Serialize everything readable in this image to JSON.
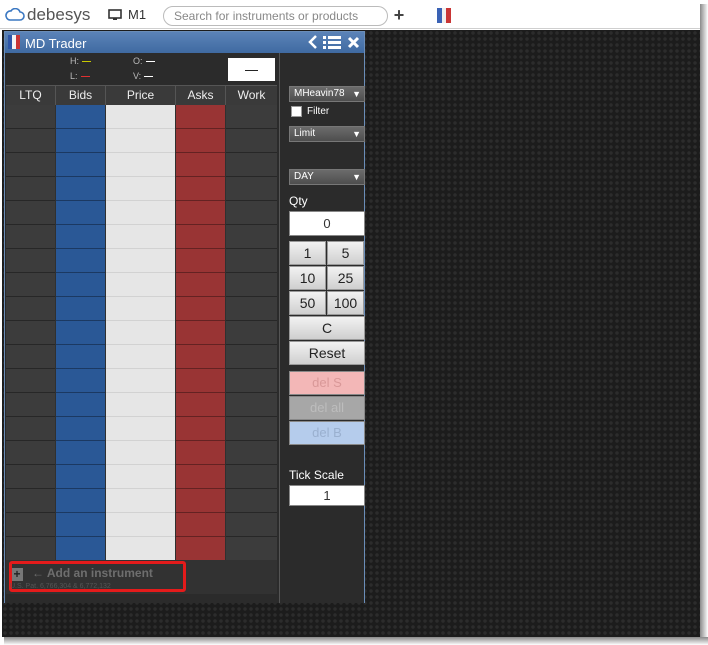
{
  "topbar": {
    "brand": "debesys",
    "workspace_label": "M1",
    "search_placeholder": "Search for instruments or products",
    "add_symbol": "+"
  },
  "widget": {
    "title": "MD Trader",
    "stats": {
      "high_label": "H:",
      "low_label": "L:",
      "open_label": "O:",
      "volume_label": "V:",
      "last_value": "—"
    },
    "columns": [
      "LTQ",
      "Bids",
      "Price",
      "Asks",
      "Work"
    ],
    "add_instrument_label": "Add an instrument",
    "footnote": "U.S. Pat. 6,766,304 & 6,772,132",
    "colors": {
      "bids": "#2a5896",
      "asks": "#993434",
      "price": "#e6e6e6",
      "titlebar": "#4a74ab",
      "highlight": "#e41b1b"
    }
  },
  "side": {
    "account": "MHeavin78",
    "filter_label": "Filter",
    "order_type": "Limit",
    "tif": "DAY",
    "qty_label": "Qty",
    "qty_value": "0",
    "qty_buttons": [
      "1",
      "5",
      "10",
      "25",
      "50",
      "100"
    ],
    "clear_label": "C",
    "reset_label": "Reset",
    "del_sell_label": "del S",
    "del_all_label": "del all",
    "del_buy_label": "del B",
    "tick_scale_label": "Tick Scale",
    "tick_scale_value": "1"
  }
}
